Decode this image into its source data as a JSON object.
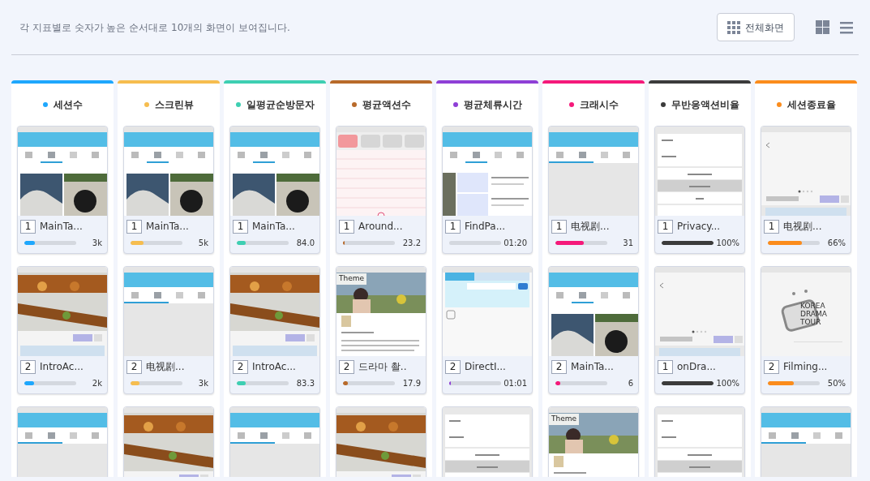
{
  "header": {
    "description": "각 지표별로 숫자가 높은 순서대로 10개의 화면이 보여집니다.",
    "fullscreen_button": "전체화면"
  },
  "metrics": [
    {
      "title": "세션수",
      "color": "#1ea7fd",
      "cards": [
        {
          "kind": "main",
          "rank": "1",
          "name": "MainTa...",
          "level": 0.2,
          "value": "3k"
        },
        {
          "kind": "food",
          "rank": "2",
          "name": "IntroAc...",
          "level": 0.18,
          "value": "2k"
        },
        {
          "kind": "blank"
        }
      ]
    },
    {
      "title": "스크린뷰",
      "color": "#f6bd4f",
      "cards": [
        {
          "kind": "main",
          "rank": "1",
          "name": "MainTa...",
          "level": 0.25,
          "value": "5k"
        },
        {
          "kind": "blank",
          "rank": "2",
          "name": "电视剧...",
          "level": 0.17,
          "value": "3k"
        },
        {
          "kind": "food"
        }
      ]
    },
    {
      "title": "일평균순방문자",
      "color": "#3ecfb2",
      "cards": [
        {
          "kind": "main",
          "rank": "1",
          "name": "MainTa...",
          "level": 0.17,
          "value": "84.0"
        },
        {
          "kind": "food",
          "rank": "2",
          "name": "IntroAc...",
          "level": 0.17,
          "value": "83.3"
        },
        {
          "kind": "blank"
        }
      ]
    },
    {
      "title": "평균액션수",
      "color": "#b86a2a",
      "cards": [
        {
          "kind": "around",
          "rank": "1",
          "name": "Around...",
          "level": 0.02,
          "value": "23.2"
        },
        {
          "kind": "theme",
          "badge": "Theme",
          "rank": "2",
          "name": "드라마 촬..",
          "level": 0.1,
          "value": "17.9"
        },
        {
          "kind": "food"
        }
      ]
    },
    {
      "title": "평균체류시간",
      "color": "#8e3fd6",
      "cards": [
        {
          "kind": "find",
          "rank": "1",
          "name": "FindPa...",
          "value": "01:20"
        },
        {
          "kind": "direction",
          "rank": "2",
          "name": "DirectI...",
          "level": 0.02,
          "value": "01:01"
        },
        {
          "kind": "settings"
        }
      ]
    },
    {
      "title": "크래시수",
      "color": "#f5197a",
      "cards": [
        {
          "kind": "blank",
          "rank": "1",
          "name": "电视剧...",
          "level": 0.55,
          "value": "31"
        },
        {
          "kind": "main",
          "rank": "2",
          "name": "MainTa...",
          "level": 0.1,
          "value": "6"
        },
        {
          "kind": "theme",
          "badge": "Theme"
        }
      ]
    },
    {
      "title": "무반응액션비율",
      "color": "#3b3b3b",
      "cards": [
        {
          "kind": "settings",
          "rank": "1",
          "name": "Privacy...",
          "level": 1,
          "value": "100%"
        },
        {
          "kind": "detail",
          "rank": "1",
          "name": "onDra...",
          "level": 1,
          "value": "100%"
        },
        {
          "kind": "settings"
        }
      ]
    },
    {
      "title": "세션종료율",
      "color": "#fb8c1c",
      "cards": [
        {
          "kind": "detail",
          "rank": "1",
          "name": "电视剧...",
          "level": 0.66,
          "value": "66%"
        },
        {
          "kind": "logo",
          "logo": "KOREA DRAMA TOUR",
          "rank": "2",
          "name": "Filming...",
          "level": 0.5,
          "value": "50%"
        },
        {
          "kind": "blank"
        }
      ]
    }
  ]
}
